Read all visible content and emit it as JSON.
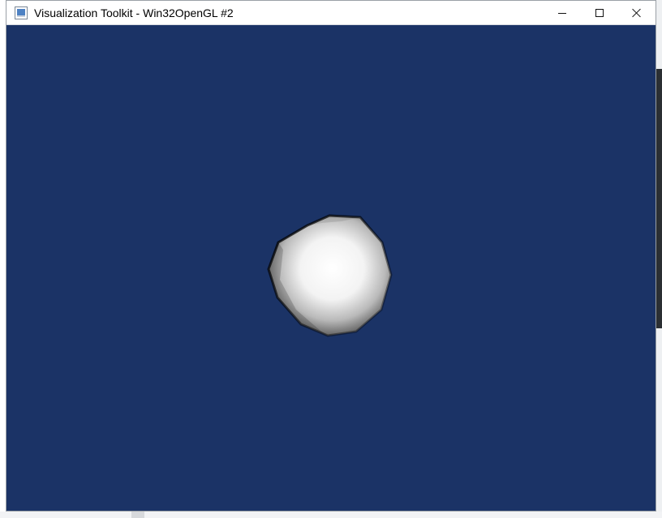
{
  "window": {
    "title": "Visualization Toolkit - Win32OpenGL #2",
    "app_icon": "vtk-window-icon"
  },
  "controls": {
    "minimize_icon": "minimize-icon",
    "maximize_icon": "maximize-icon",
    "close_icon": "close-icon"
  },
  "scene": {
    "background_color": "#1b3366",
    "object": "sphere",
    "object_color": "#ffffff"
  }
}
